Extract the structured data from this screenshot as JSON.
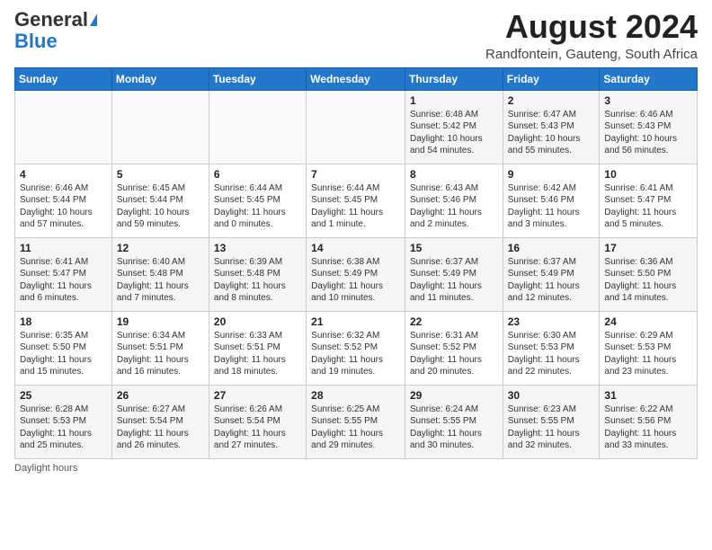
{
  "header": {
    "logo_general": "General",
    "logo_blue": "Blue",
    "title": "August 2024",
    "location": "Randfontein, Gauteng, South Africa"
  },
  "days_of_week": [
    "Sunday",
    "Monday",
    "Tuesday",
    "Wednesday",
    "Thursday",
    "Friday",
    "Saturday"
  ],
  "weeks": [
    [
      {
        "day": "",
        "info": ""
      },
      {
        "day": "",
        "info": ""
      },
      {
        "day": "",
        "info": ""
      },
      {
        "day": "",
        "info": ""
      },
      {
        "day": "1",
        "info": "Sunrise: 6:48 AM\nSunset: 5:42 PM\nDaylight: 10 hours\nand 54 minutes."
      },
      {
        "day": "2",
        "info": "Sunrise: 6:47 AM\nSunset: 5:43 PM\nDaylight: 10 hours\nand 55 minutes."
      },
      {
        "day": "3",
        "info": "Sunrise: 6:46 AM\nSunset: 5:43 PM\nDaylight: 10 hours\nand 56 minutes."
      }
    ],
    [
      {
        "day": "4",
        "info": "Sunrise: 6:46 AM\nSunset: 5:44 PM\nDaylight: 10 hours\nand 57 minutes."
      },
      {
        "day": "5",
        "info": "Sunrise: 6:45 AM\nSunset: 5:44 PM\nDaylight: 10 hours\nand 59 minutes."
      },
      {
        "day": "6",
        "info": "Sunrise: 6:44 AM\nSunset: 5:45 PM\nDaylight: 11 hours\nand 0 minutes."
      },
      {
        "day": "7",
        "info": "Sunrise: 6:44 AM\nSunset: 5:45 PM\nDaylight: 11 hours\nand 1 minute."
      },
      {
        "day": "8",
        "info": "Sunrise: 6:43 AM\nSunset: 5:46 PM\nDaylight: 11 hours\nand 2 minutes."
      },
      {
        "day": "9",
        "info": "Sunrise: 6:42 AM\nSunset: 5:46 PM\nDaylight: 11 hours\nand 3 minutes."
      },
      {
        "day": "10",
        "info": "Sunrise: 6:41 AM\nSunset: 5:47 PM\nDaylight: 11 hours\nand 5 minutes."
      }
    ],
    [
      {
        "day": "11",
        "info": "Sunrise: 6:41 AM\nSunset: 5:47 PM\nDaylight: 11 hours\nand 6 minutes."
      },
      {
        "day": "12",
        "info": "Sunrise: 6:40 AM\nSunset: 5:48 PM\nDaylight: 11 hours\nand 7 minutes."
      },
      {
        "day": "13",
        "info": "Sunrise: 6:39 AM\nSunset: 5:48 PM\nDaylight: 11 hours\nand 8 minutes."
      },
      {
        "day": "14",
        "info": "Sunrise: 6:38 AM\nSunset: 5:49 PM\nDaylight: 11 hours\nand 10 minutes."
      },
      {
        "day": "15",
        "info": "Sunrise: 6:37 AM\nSunset: 5:49 PM\nDaylight: 11 hours\nand 11 minutes."
      },
      {
        "day": "16",
        "info": "Sunrise: 6:37 AM\nSunset: 5:49 PM\nDaylight: 11 hours\nand 12 minutes."
      },
      {
        "day": "17",
        "info": "Sunrise: 6:36 AM\nSunset: 5:50 PM\nDaylight: 11 hours\nand 14 minutes."
      }
    ],
    [
      {
        "day": "18",
        "info": "Sunrise: 6:35 AM\nSunset: 5:50 PM\nDaylight: 11 hours\nand 15 minutes."
      },
      {
        "day": "19",
        "info": "Sunrise: 6:34 AM\nSunset: 5:51 PM\nDaylight: 11 hours\nand 16 minutes."
      },
      {
        "day": "20",
        "info": "Sunrise: 6:33 AM\nSunset: 5:51 PM\nDaylight: 11 hours\nand 18 minutes."
      },
      {
        "day": "21",
        "info": "Sunrise: 6:32 AM\nSunset: 5:52 PM\nDaylight: 11 hours\nand 19 minutes."
      },
      {
        "day": "22",
        "info": "Sunrise: 6:31 AM\nSunset: 5:52 PM\nDaylight: 11 hours\nand 20 minutes."
      },
      {
        "day": "23",
        "info": "Sunrise: 6:30 AM\nSunset: 5:53 PM\nDaylight: 11 hours\nand 22 minutes."
      },
      {
        "day": "24",
        "info": "Sunrise: 6:29 AM\nSunset: 5:53 PM\nDaylight: 11 hours\nand 23 minutes."
      }
    ],
    [
      {
        "day": "25",
        "info": "Sunrise: 6:28 AM\nSunset: 5:53 PM\nDaylight: 11 hours\nand 25 minutes."
      },
      {
        "day": "26",
        "info": "Sunrise: 6:27 AM\nSunset: 5:54 PM\nDaylight: 11 hours\nand 26 minutes."
      },
      {
        "day": "27",
        "info": "Sunrise: 6:26 AM\nSunset: 5:54 PM\nDaylight: 11 hours\nand 27 minutes."
      },
      {
        "day": "28",
        "info": "Sunrise: 6:25 AM\nSunset: 5:55 PM\nDaylight: 11 hours\nand 29 minutes."
      },
      {
        "day": "29",
        "info": "Sunrise: 6:24 AM\nSunset: 5:55 PM\nDaylight: 11 hours\nand 30 minutes."
      },
      {
        "day": "30",
        "info": "Sunrise: 6:23 AM\nSunset: 5:55 PM\nDaylight: 11 hours\nand 32 minutes."
      },
      {
        "day": "31",
        "info": "Sunrise: 6:22 AM\nSunset: 5:56 PM\nDaylight: 11 hours\nand 33 minutes."
      }
    ]
  ],
  "footer": {
    "note": "Daylight hours"
  }
}
